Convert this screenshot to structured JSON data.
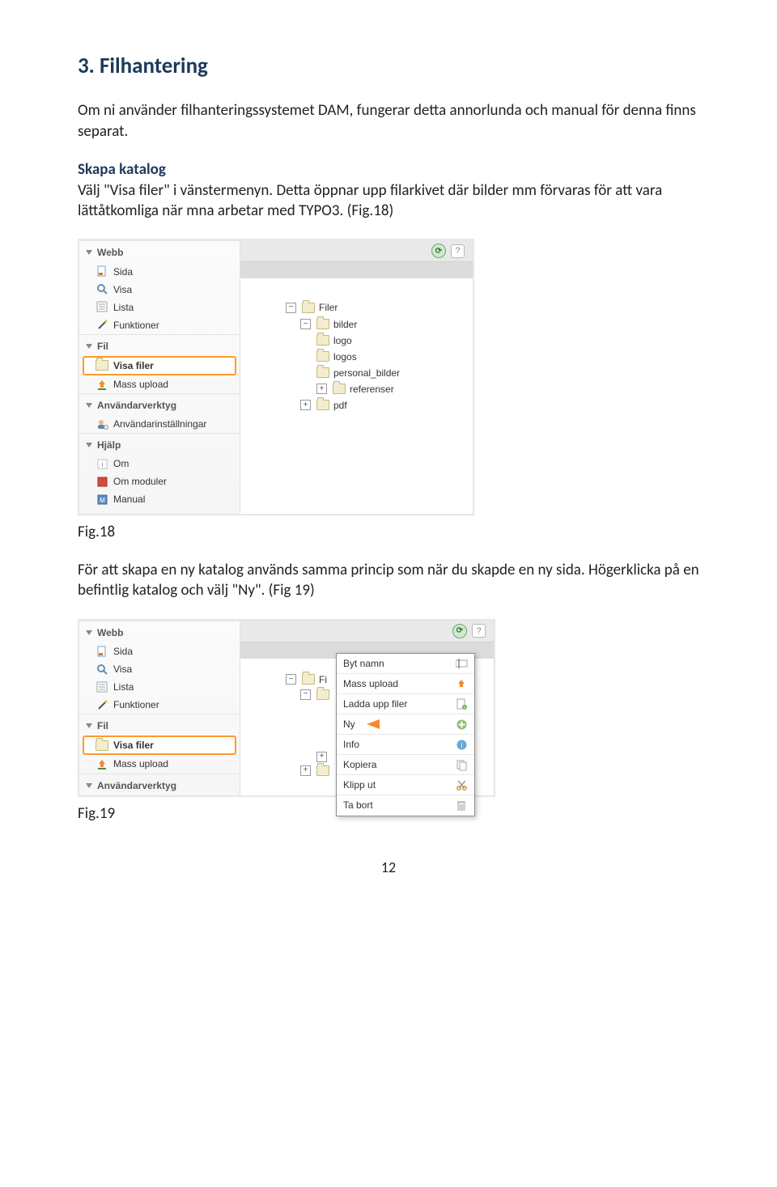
{
  "heading": "3. Filhantering",
  "intro": "Om ni använder filhanteringssystemet DAM, fungerar detta annorlunda och manual för denna finns separat.",
  "subhead": "Skapa katalog",
  "sub_text": "Välj \"Visa filer\" i vänstermenyn. Detta öppnar upp filarkivet där bilder mm förvaras för att vara lättåtkomliga när mna arbetar med TYPO3. (Fig.18)",
  "fig18_caption": "Fig.18",
  "mid_text": "För att skapa en ny katalog används samma princip som när du skapde en ny sida. Högerklicka på en befintlig katalog  och välj \"Ny\". (Fig 19)",
  "fig19_caption": "Fig.19",
  "page_number": "12",
  "menu": {
    "webb": "Webb",
    "sida": "Sida",
    "visa": "Visa",
    "lista": "Lista",
    "funktioner": "Funktioner",
    "fil": "Fil",
    "visa_filer": "Visa filer",
    "mass_upload": "Mass upload",
    "anv_verktyg": "Användarverktyg",
    "anv_installningar": "Användarinställningar",
    "hjalp": "Hjälp",
    "om": "Om",
    "om_moduler": "Om moduler",
    "manual": "Manual"
  },
  "tree": {
    "filer": "Filer",
    "bilder": "bilder",
    "logo": "logo",
    "logos": "logos",
    "personal_bilder": "personal_bilder",
    "referenser": "referenser",
    "pdf": "pdf",
    "fi_stub": "Fi"
  },
  "ctx": {
    "byt_namn": "Byt namn",
    "mass_upload": "Mass upload",
    "ladda_upp": "Ladda upp filer",
    "ny": "Ny",
    "info": "Info",
    "kopiera": "Kopiera",
    "klipp_ut": "Klipp ut",
    "ta_bort": "Ta bort"
  },
  "icons": {
    "refresh": "⟳",
    "help": "?",
    "minus": "−",
    "plus": "+"
  }
}
